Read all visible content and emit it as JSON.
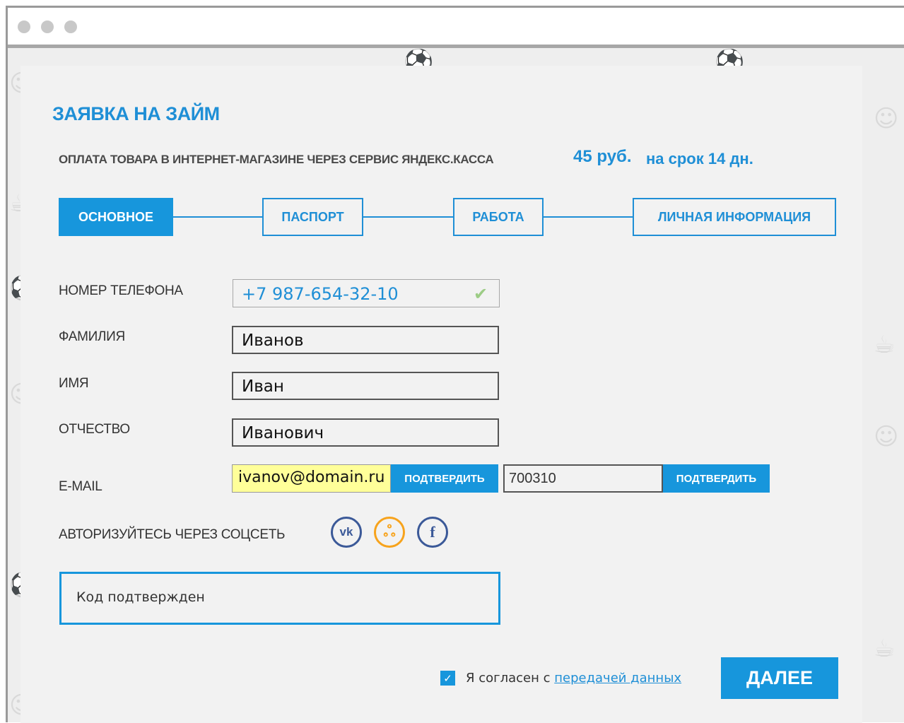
{
  "form": {
    "title": "ЗАЯВКА НА ЗАЙМ",
    "subtitle": "ОПЛАТА ТОВАРА В ИНТЕРНЕТ-МАГАЗИНЕ ЧЕРЕЗ СЕРВИС ЯНДЕКС.КАССА",
    "amount": "45 руб.",
    "term": "на срок 14 дн."
  },
  "steps": [
    {
      "label": "ОСНОВНОЕ",
      "active": true
    },
    {
      "label": "ПАСПОРТ",
      "active": false
    },
    {
      "label": "РАБОТА",
      "active": false
    },
    {
      "label": "ЛИЧНАЯ ИНФОРМАЦИЯ",
      "active": false
    }
  ],
  "fields": {
    "phone": {
      "label": "НОМЕР ТЕЛЕФОНА",
      "value": "+7 987-654-32-10"
    },
    "lastname": {
      "label": "ФАМИЛИЯ",
      "value": "Иванов"
    },
    "firstname": {
      "label": "ИМЯ",
      "value": "Иван"
    },
    "patronymic": {
      "label": "ОТЧЕСТВО",
      "value": "Иванович"
    },
    "email": {
      "label": "E-MAIL",
      "value": "ivanov@domain.ru",
      "confirm_label": "ПОДТВЕРДИТЬ"
    },
    "code": {
      "value": "700310",
      "confirm_label": "ПОДТВЕРДИТЬ"
    }
  },
  "social": {
    "label": "АВТОРИЗУЙТЕСЬ ЧЕРЕЗ СОЦСЕТЬ",
    "icons": [
      "vk-icon",
      "odnoklassniki-icon",
      "facebook-icon"
    ],
    "vk_glyph": "vk",
    "ok_glyph": "ஃ",
    "fb_glyph": "f"
  },
  "message": "Код подтвержден",
  "agreement": {
    "text": "Я согласен с",
    "link": "передачей данных",
    "checked": true
  },
  "next_button": "ДАЛЕЕ",
  "colors": {
    "accent": "#1796dc",
    "email_highlight": "#ffff99",
    "check": "#9ccc85",
    "ok_orange": "#f7a31c",
    "social_blue": "#3b5998"
  }
}
